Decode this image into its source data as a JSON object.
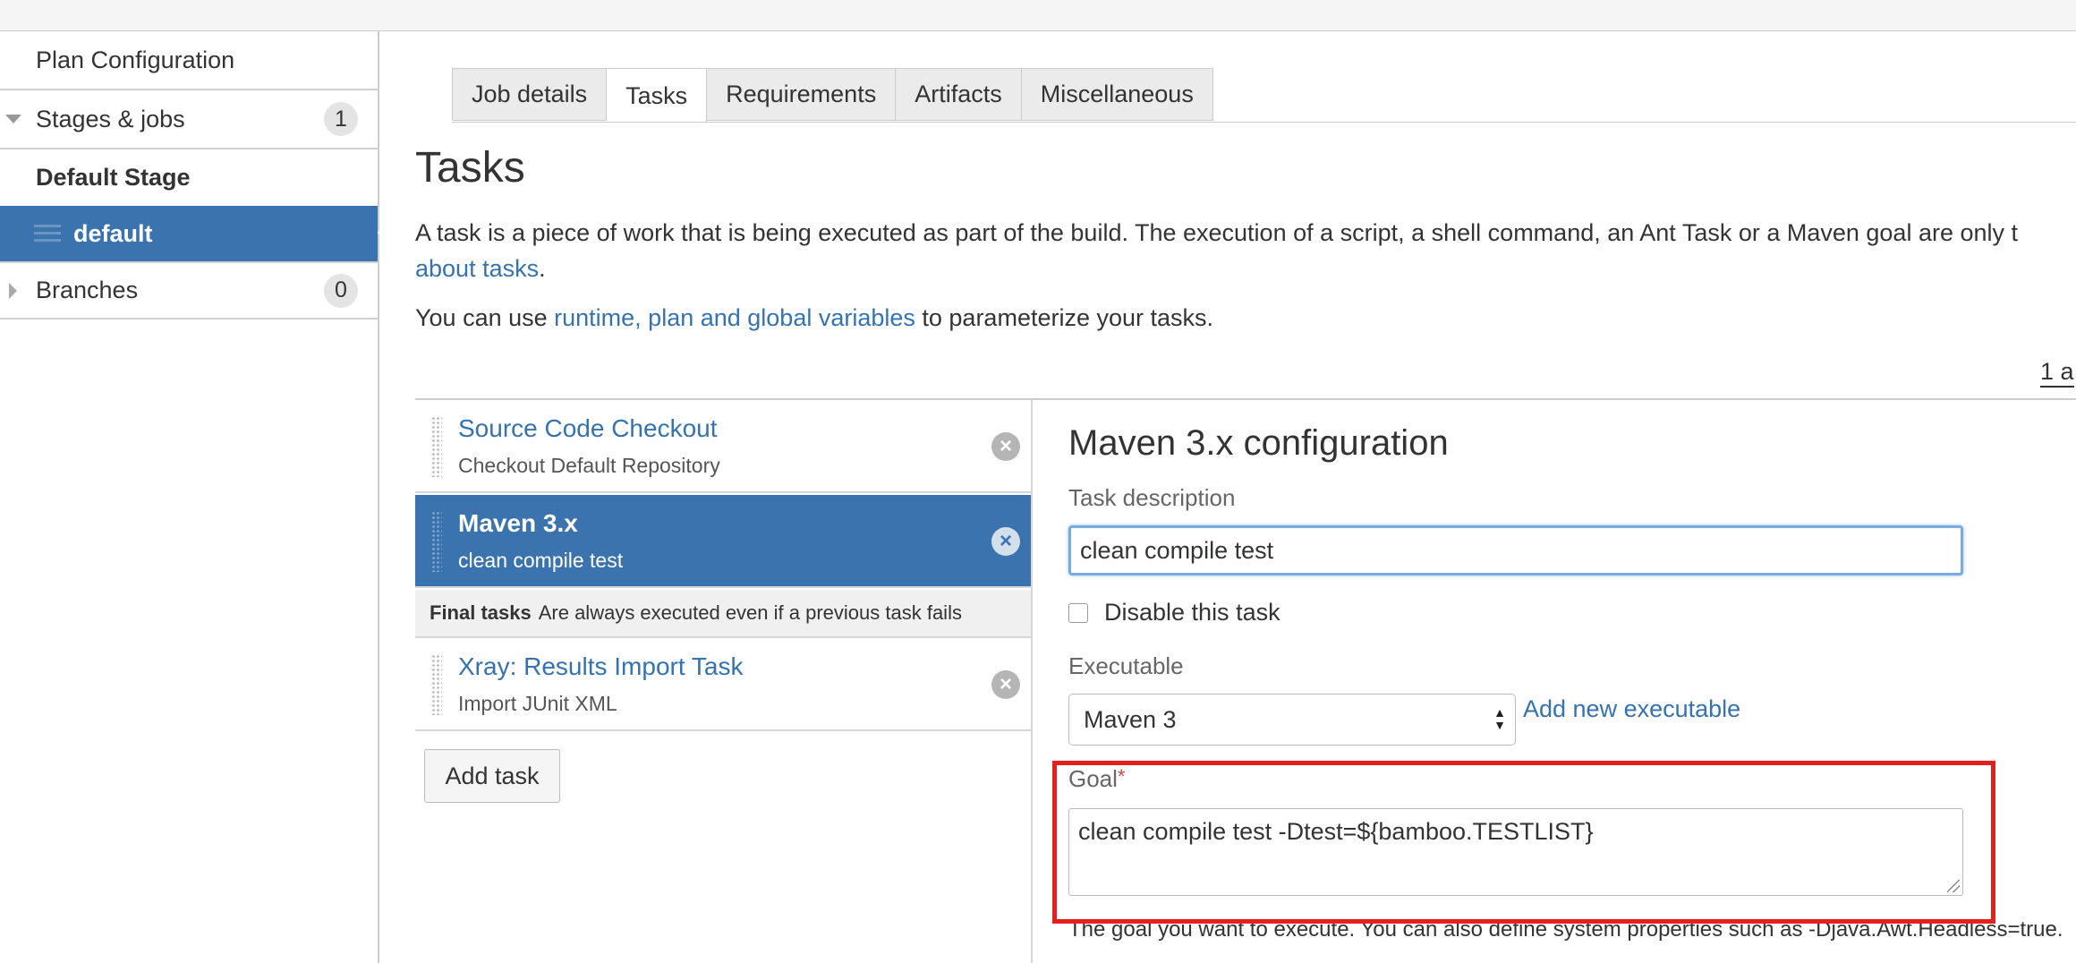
{
  "sidebar": {
    "plan_configuration": "Plan Configuration",
    "stages_label": "Stages & jobs",
    "stages_count": "1",
    "default_stage": "Default Stage",
    "default_job": "default",
    "branches_label": "Branches",
    "branches_count": "0"
  },
  "tabs": [
    "Job details",
    "Tasks",
    "Requirements",
    "Artifacts",
    "Miscellaneous"
  ],
  "active_tab": "Tasks",
  "main": {
    "title": "Tasks",
    "intro_text": "A task is a piece of work that is being executed as part of the build. The execution of a script, a shell command, an Ant Task or a Maven goal are only t",
    "intro_link": "about tasks",
    "intro_end": ".",
    "vars_prefix": "You can use ",
    "vars_link": "runtime, plan and global variables",
    "vars_suffix": " to parameterize your tasks.",
    "counter": "1 a"
  },
  "tasks": [
    {
      "name": "Source Code Checkout",
      "description": "Checkout Default Repository"
    },
    {
      "name": "Maven 3.x",
      "description": "clean compile test"
    }
  ],
  "final_tasks": {
    "label": "Final tasks",
    "note": "Are always executed even if a previous task fails",
    "items": [
      {
        "name": "Xray: Results Import Task",
        "description": "Import JUnit XML"
      }
    ]
  },
  "add_task_label": "Add task",
  "config": {
    "title": "Maven 3.x configuration",
    "task_description_label": "Task description",
    "task_description_value": "clean compile test",
    "disable_label": "Disable this task",
    "executable_label": "Executable",
    "executable_value": "Maven 3",
    "add_executable_label": "Add new executable",
    "goal_label": "Goal",
    "goal_required_mark": "*",
    "goal_value": "clean compile test -Dtest=${bamboo.TESTLIST}",
    "goal_help": "The goal you want to execute. You can also define system properties such as -Djava.Awt.Headless=true."
  },
  "colors": {
    "accent": "#3b73af",
    "link": "#3572b0",
    "highlight": "#e3201e",
    "required": "#d04437"
  }
}
